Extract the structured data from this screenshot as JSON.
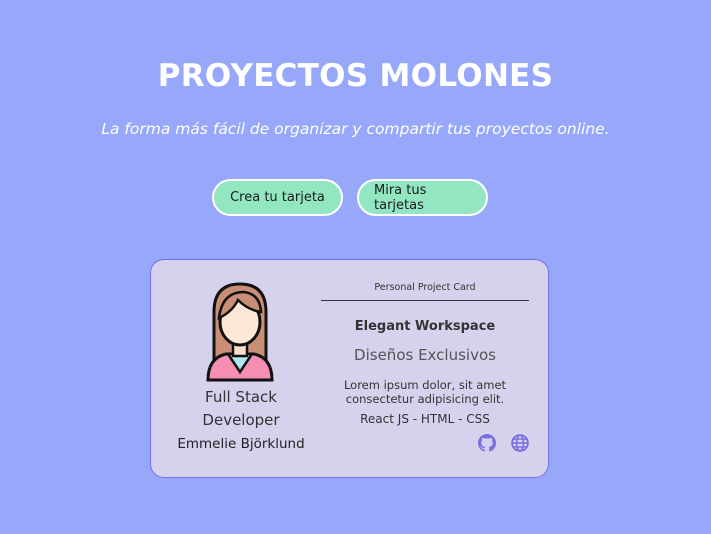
{
  "header": {
    "title": "PROYECTOS MOLONES",
    "subtitle": "La forma más fácil de organizar y compartir tus proyectos online."
  },
  "actions": {
    "create_label": "Crea tu tarjeta",
    "view_label": "Mira tus tarjetas"
  },
  "card": {
    "label": "Personal Project Card",
    "project_name": "Elegant Workspace",
    "slogan": "Diseños Exclusivos",
    "description": "Lorem ipsum dolor, sit amet consectetur adipisicing elit.",
    "technologies": "React JS - HTML - CSS",
    "author_job": "Full Stack Developer",
    "author_name": "Emmelie Björklund",
    "icons": [
      "github-icon",
      "globe-icon"
    ]
  },
  "colors": {
    "background": "#97a8fb",
    "button": "#93e6c2",
    "card": "#d6d1ec",
    "card_border": "#7a6ee0",
    "icon": "#7a6ee0"
  }
}
